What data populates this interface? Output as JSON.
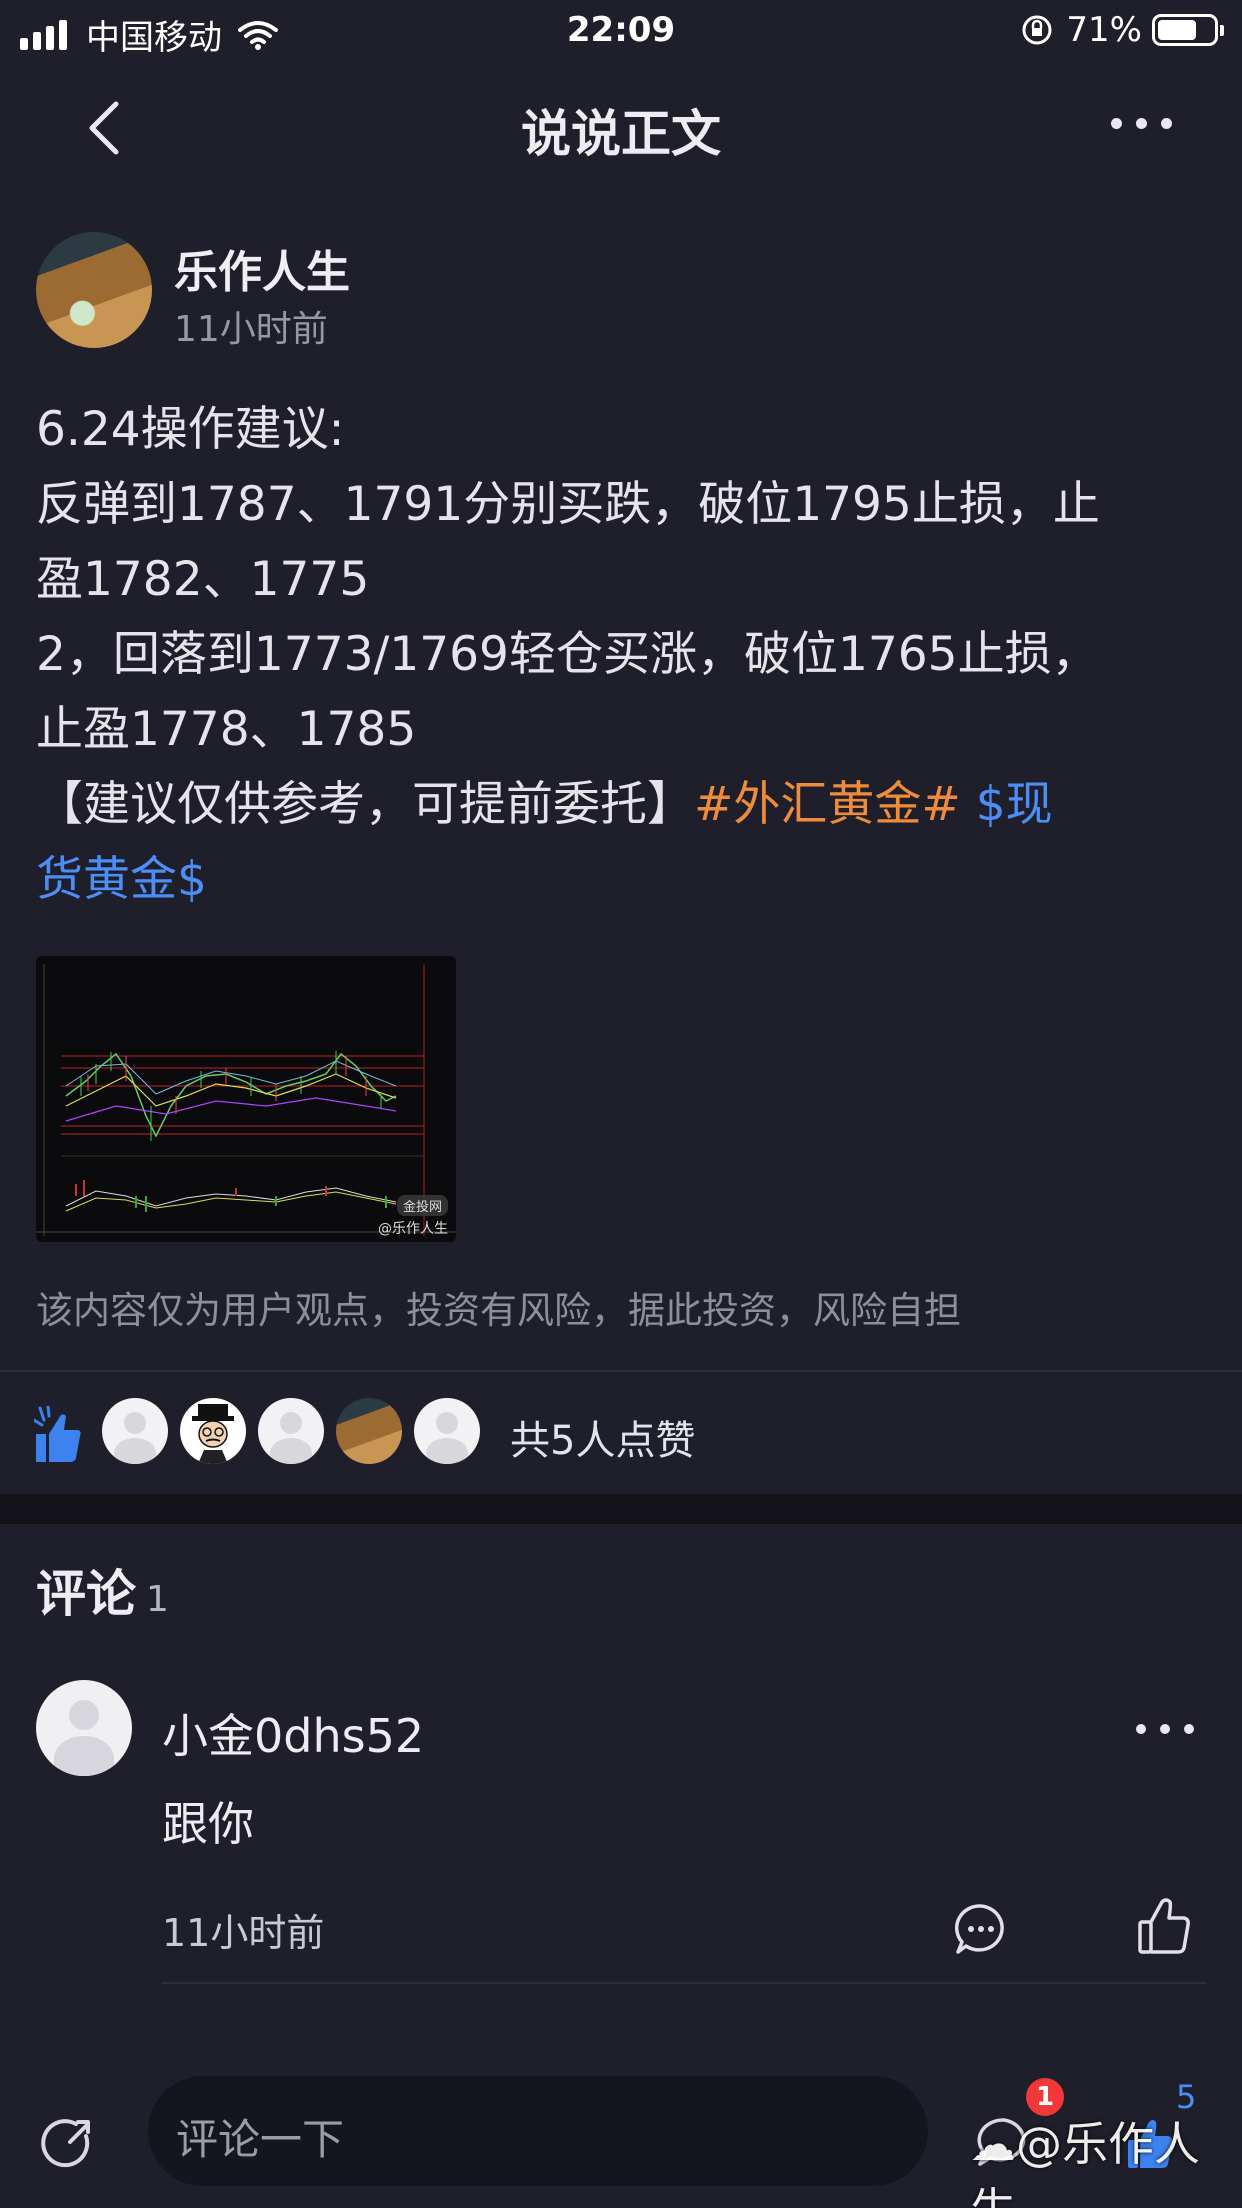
{
  "status": {
    "carrier": "中国移动",
    "time": "22:09",
    "battery": "71%"
  },
  "nav": {
    "title": "说说正文"
  },
  "post": {
    "author": "乐作人生",
    "time": "11小时前",
    "line1": "6.24操作建议:",
    "line2": "反弹到1787、1791分别买跌，破位1795止损，止",
    "line3": "盈1782、1775",
    "line4": "2，回落到1773/1769轻仓买涨，破位1765止损，",
    "line5": "止盈1778、1785",
    "line6_prefix": "【建议仅供参考，可提前委托】",
    "topic": "#外汇黄金#",
    "stock_a": " $现",
    "stock_b": "货黄金$",
    "image_watermark_site": "金投网",
    "image_watermark_user": "@乐作人生",
    "disclaimer": "该内容仅为用户观点，投资有风险，据此投资，风险自担"
  },
  "likes": {
    "summary": "共5人点赞"
  },
  "comments": {
    "label": "评论",
    "count": "1",
    "items": [
      {
        "user": "小金0dhs52",
        "text": "跟你",
        "time": "11小时前"
      }
    ]
  },
  "bottom": {
    "placeholder": "评论一下",
    "comment_badge": "1",
    "like_count": "5",
    "watermark": "@乐作人生"
  },
  "colors": {
    "background": "#1f1f2b",
    "topic": "#ef8c3c",
    "link": "#4c8ef6",
    "badge": "#f03838"
  }
}
